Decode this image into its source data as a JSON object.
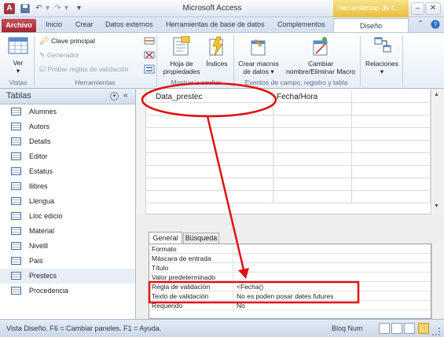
{
  "window": {
    "title": "Microsoft Access",
    "context_tab_title": "Herramientas de t..."
  },
  "tabs": [
    "Archivo",
    "Inicio",
    "Crear",
    "Datos externos",
    "Herramientas de base de datos",
    "Complementos",
    "Diseño"
  ],
  "ribbon": {
    "vistas": {
      "ver_label": "Ver",
      "group_label": "Vistas"
    },
    "herramientas": {
      "clave_principal": "Clave principal",
      "generador": "Generador",
      "probar_reglas": "Probar reglas de validación",
      "group_label": "Herramientas"
    },
    "mostrar": {
      "hoja_propiedades": [
        "Hoja de",
        "propiedades"
      ],
      "indices": "Índices",
      "group_label": "Mostrar u ocultar"
    },
    "eventos": {
      "crear_macros": [
        "Crear macros",
        "de datos ▾"
      ],
      "cambiar_nombre": [
        "Cambiar",
        "nombre/Eliminar Macro"
      ],
      "group_label": "Eventos de campo, registro y tabla"
    },
    "relaciones": {
      "label": "Relaciones"
    }
  },
  "nav_pane": {
    "title": "Tablas",
    "items": [
      "Alumnes",
      "Autors",
      "Detalls",
      "Editor",
      "Estatus",
      "llibres",
      "Llengua",
      "Lloc edicio",
      "Material",
      "Nivelll",
      "Pais",
      "Prestecs",
      "Procedencia"
    ],
    "selected": "Prestecs"
  },
  "design_grid": {
    "field_name": "Data_prestec",
    "data_type": "Fecha/Hora"
  },
  "properties": {
    "tabs": [
      "General",
      "Búsqueda"
    ],
    "rows": [
      {
        "name": "Formato",
        "value": ""
      },
      {
        "name": "Máscara de entrada",
        "value": ""
      },
      {
        "name": "Título",
        "value": ""
      },
      {
        "name": "Valor predeterminado",
        "value": ""
      },
      {
        "name": "Regla de validación",
        "value": "<Fecha()"
      },
      {
        "name": "Texto de validación",
        "value": "No es poden posar dates futures"
      },
      {
        "name": "Requerido",
        "value": "No"
      }
    ]
  },
  "status_bar": {
    "text": "Vista Diseño.  F6 = Cambiar paneles.  F1 = Ayuda.",
    "bloq_num": "Bloq Num"
  },
  "colors": {
    "archivo_tab": "#a52a35",
    "context_tab": "#e9be3a",
    "annotation": "#e01010"
  }
}
